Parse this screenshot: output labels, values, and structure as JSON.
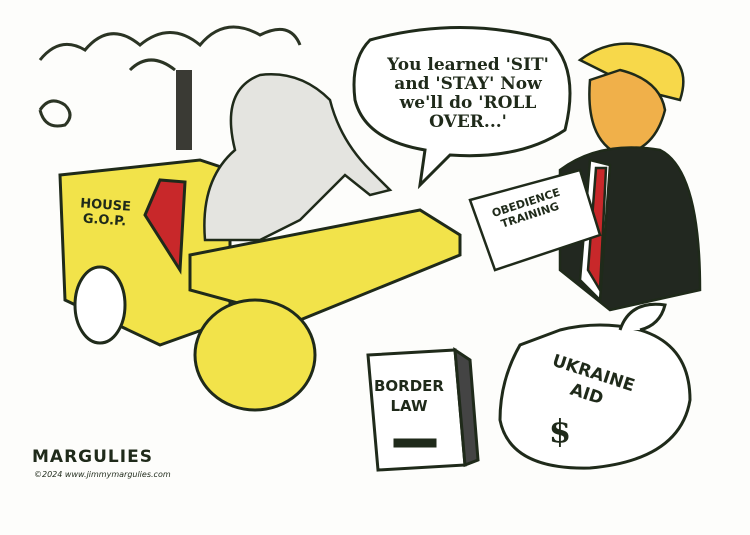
{
  "cartoon": {
    "speech_bubble": "You learned 'SIT' and 'STAY' Now we'll do 'ROLL OVER...'",
    "steamroller_label": "HOUSE G.O.P.",
    "document_label": "OBEDIENCE TRAINING",
    "book_label": "BORDER LAW",
    "sack_label": "UKRAINE AID",
    "sack_symbol": "$",
    "signature": "MARGULIES",
    "copyright": "©2024 www.jimmymargulies.com"
  },
  "colors": {
    "yellow": "#f2e34a",
    "ink": "#1f2a1a",
    "red": "#c8282a",
    "orange": "#f0b04a",
    "grey": "#e4e4e0"
  }
}
